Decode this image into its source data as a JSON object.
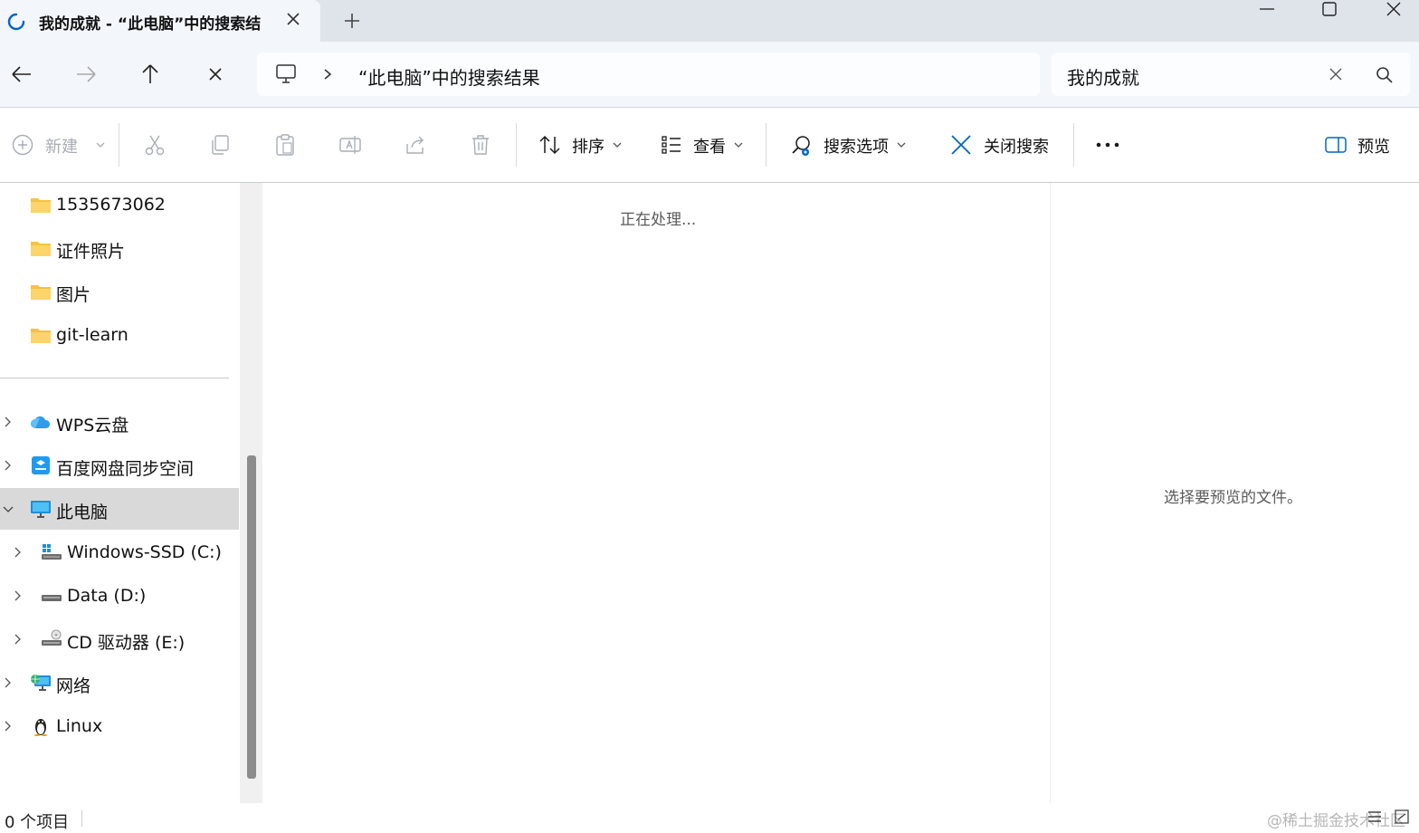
{
  "tab": {
    "title": "我的成就 - “此电脑”中的搜索结"
  },
  "address": {
    "location": "“此电脑”中的搜索结果"
  },
  "search": {
    "value": "我的成就"
  },
  "toolbar": {
    "new_label": "新建",
    "sort_label": "排序",
    "view_label": "查看",
    "search_options_label": "搜索选项",
    "close_search_label": "关闭搜索",
    "preview_label": "预览"
  },
  "sidebar": {
    "folders": [
      {
        "label": "1535673062"
      },
      {
        "label": "证件照片"
      },
      {
        "label": "图片"
      },
      {
        "label": "git-learn"
      }
    ],
    "tree": [
      {
        "label": "WPS云盘",
        "icon": "cloud-icon"
      },
      {
        "label": "百度网盘同步空间",
        "icon": "baidu-netdisk-icon"
      },
      {
        "label": "此电脑",
        "icon": "computer-icon"
      },
      {
        "label": "Windows-SSD (C:)",
        "icon": "windows-drive-icon"
      },
      {
        "label": "Data (D:)",
        "icon": "drive-icon"
      },
      {
        "label": "CD 驱动器 (E:)",
        "icon": "cd-drive-icon"
      },
      {
        "label": "网络",
        "icon": "network-icon"
      },
      {
        "label": "Linux",
        "icon": "linux-penguin-icon"
      }
    ]
  },
  "main": {
    "status_text": "正在处理..."
  },
  "preview": {
    "hint": "选择要预览的文件。"
  },
  "statusbar": {
    "item_count": "0 个项目",
    "watermark": "@稀土掘金技术社区"
  },
  "colors": {
    "accent": "#0067c0",
    "folder": "#f5c242",
    "selected": "#d9d9d9"
  }
}
